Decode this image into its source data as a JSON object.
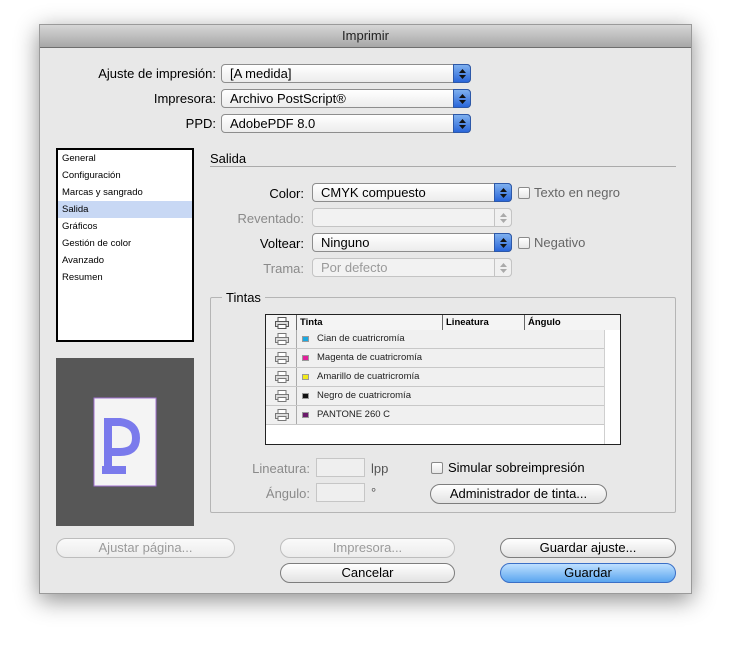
{
  "window": {
    "title": "Imprimir"
  },
  "top": {
    "preset_label": "Ajuste de impresión:",
    "preset_value": "[A medida]",
    "printer_label": "Impresora:",
    "printer_value": "Archivo PostScript®",
    "ppd_label": "PPD:",
    "ppd_value": "AdobePDF 8.0"
  },
  "sidebar": {
    "items": [
      {
        "label": "General"
      },
      {
        "label": "Configuración"
      },
      {
        "label": "Marcas y sangrado"
      },
      {
        "label": "Salida",
        "selected": true
      },
      {
        "label": "Gráficos"
      },
      {
        "label": "Gestión de color"
      },
      {
        "label": "Avanzado"
      },
      {
        "label": "Resumen"
      }
    ]
  },
  "output": {
    "section_title": "Salida",
    "color_label": "Color:",
    "color_value": "CMYK compuesto",
    "text_black_label": "Texto en negro",
    "trap_label": "Reventado:",
    "trap_value": "",
    "flip_label": "Voltear:",
    "flip_value": "Ninguno",
    "negative_label": "Negativo",
    "screen_label": "Trama:",
    "screen_value": "Por defecto"
  },
  "inks": {
    "group_title": "Tintas",
    "columns": [
      "Tinta",
      "Lineatura",
      "Ángulo"
    ],
    "rows": [
      {
        "name": "Cian de cuatricromía",
        "color": "#1aa8e0"
      },
      {
        "name": "Magenta de cuatricromía",
        "color": "#e0209a"
      },
      {
        "name": "Amarillo de cuatricromía",
        "color": "#f2ea1a"
      },
      {
        "name": "Negro de cuatricromía",
        "color": "#111111"
      },
      {
        "name": "PANTONE 260 C",
        "color": "#6a1a6a"
      }
    ],
    "frequency_label": "Lineatura:",
    "frequency_unit": "lpp",
    "angle_label": "Ángulo:",
    "angle_unit": "°",
    "simulate_label": "Simular sobreimpresión",
    "ink_manager_label": "Administrador de tinta..."
  },
  "buttons": {
    "page_setup": "Ajustar página...",
    "printer": "Impresora...",
    "save_preset": "Guardar ajuste...",
    "cancel": "Cancelar",
    "save": "Guardar"
  },
  "colors": {
    "accent": "#3a7ee0",
    "selection": "#c8d8f4"
  }
}
